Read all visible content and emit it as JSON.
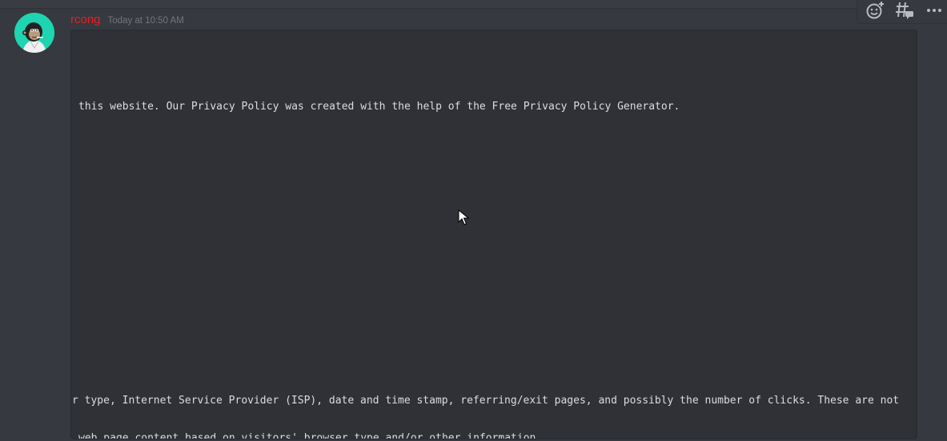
{
  "message": {
    "author": "rcong",
    "timestamp": "Today at 10:50 AM",
    "author_color": "#e91e1e"
  },
  "code_block": {
    "lines": [
      "this website. Our Privacy Policy was created with the help of the Free Privacy Policy Generator.",
      "r type, Internet Service Provider (ISP), date and time stamp, referring/exit pages, and possibly the number of clicks. These are not",
      "web page content based on visitors' browser type and/or other information."
    ]
  },
  "toolbar": {
    "icons": [
      "add-reaction-icon",
      "create-thread-icon",
      "more-icon"
    ]
  }
}
